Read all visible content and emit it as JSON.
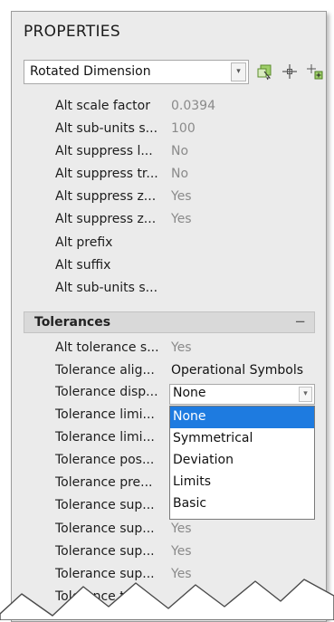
{
  "panel": {
    "title": "PROPERTIES",
    "object_type": "Rotated Dimension",
    "toolbar_icons": [
      "quick-select-icon",
      "select-objects-icon",
      "toggle-pickadd-icon"
    ]
  },
  "rows": [
    {
      "label": "Alt scale factor",
      "value": "0.0394"
    },
    {
      "label": "Alt sub-units s...",
      "value": "100"
    },
    {
      "label": "Alt suppress l...",
      "value": "No"
    },
    {
      "label": "Alt suppress tr...",
      "value": "No"
    },
    {
      "label": "Alt suppress z...",
      "value": "Yes"
    },
    {
      "label": "Alt suppress z...",
      "value": "Yes"
    },
    {
      "label": "Alt prefix",
      "value": ""
    },
    {
      "label": "Alt suffix",
      "value": ""
    },
    {
      "label": "Alt sub-units s...",
      "value": ""
    }
  ],
  "section": {
    "label": "Tolerances",
    "toggle": "−"
  },
  "tolerance_rows": [
    {
      "label": "Alt tolerance s...",
      "value": "Yes"
    },
    {
      "label": "Tolerance alig...",
      "value": "Operational Symbols"
    },
    {
      "label": "Tolerance disp...",
      "value": "None"
    },
    {
      "label": "Tolerance limi...",
      "value": ""
    },
    {
      "label": "Tolerance limi...",
      "value": ""
    },
    {
      "label": "Tolerance pos...",
      "value": ""
    },
    {
      "label": "Tolerance pre...",
      "value": ""
    },
    {
      "label": "Tolerance sup...",
      "value": ""
    },
    {
      "label": "Tolerance sup...",
      "value": "Yes"
    },
    {
      "label": "Tolerance sup...",
      "value": "Yes"
    },
    {
      "label": "Tolerance sup...",
      "value": "Yes"
    },
    {
      "label": "Tolerance text...",
      "value": ""
    }
  ],
  "dropdown": {
    "selected": "None",
    "options": [
      "None",
      "Symmetrical",
      "Deviation",
      "Limits",
      "Basic"
    ]
  },
  "colors": {
    "panel_bg": "#ebebeb",
    "selection": "#1e7be0",
    "section_bg": "#d9d9d9"
  }
}
